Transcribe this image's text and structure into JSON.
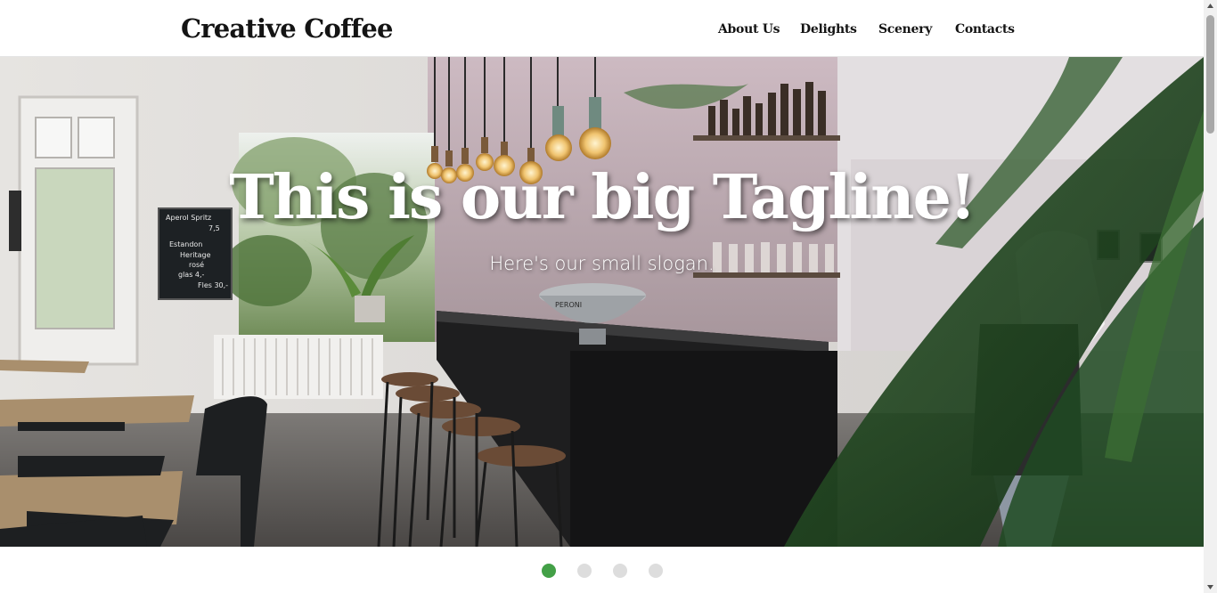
{
  "brand": {
    "name": "Creative Coffee"
  },
  "nav": {
    "items": [
      {
        "label": "About Us"
      },
      {
        "label": "Delights"
      },
      {
        "label": "Scenery"
      },
      {
        "label": "Contacts"
      }
    ]
  },
  "hero": {
    "tagline": "This is our big Tagline!",
    "slogan": "Here's our small slogan.",
    "chalkboard": [
      "Aperol Spritz",
      "7,5",
      "Estandon",
      "Heritage",
      "rosé",
      "glas 4,-",
      "Fles 30,-"
    ],
    "bucket_label": "PERONI"
  },
  "carousel": {
    "slide_count": 4,
    "active_index": 0,
    "active_color": "#43a047",
    "inactive_color": "#dddddd"
  }
}
